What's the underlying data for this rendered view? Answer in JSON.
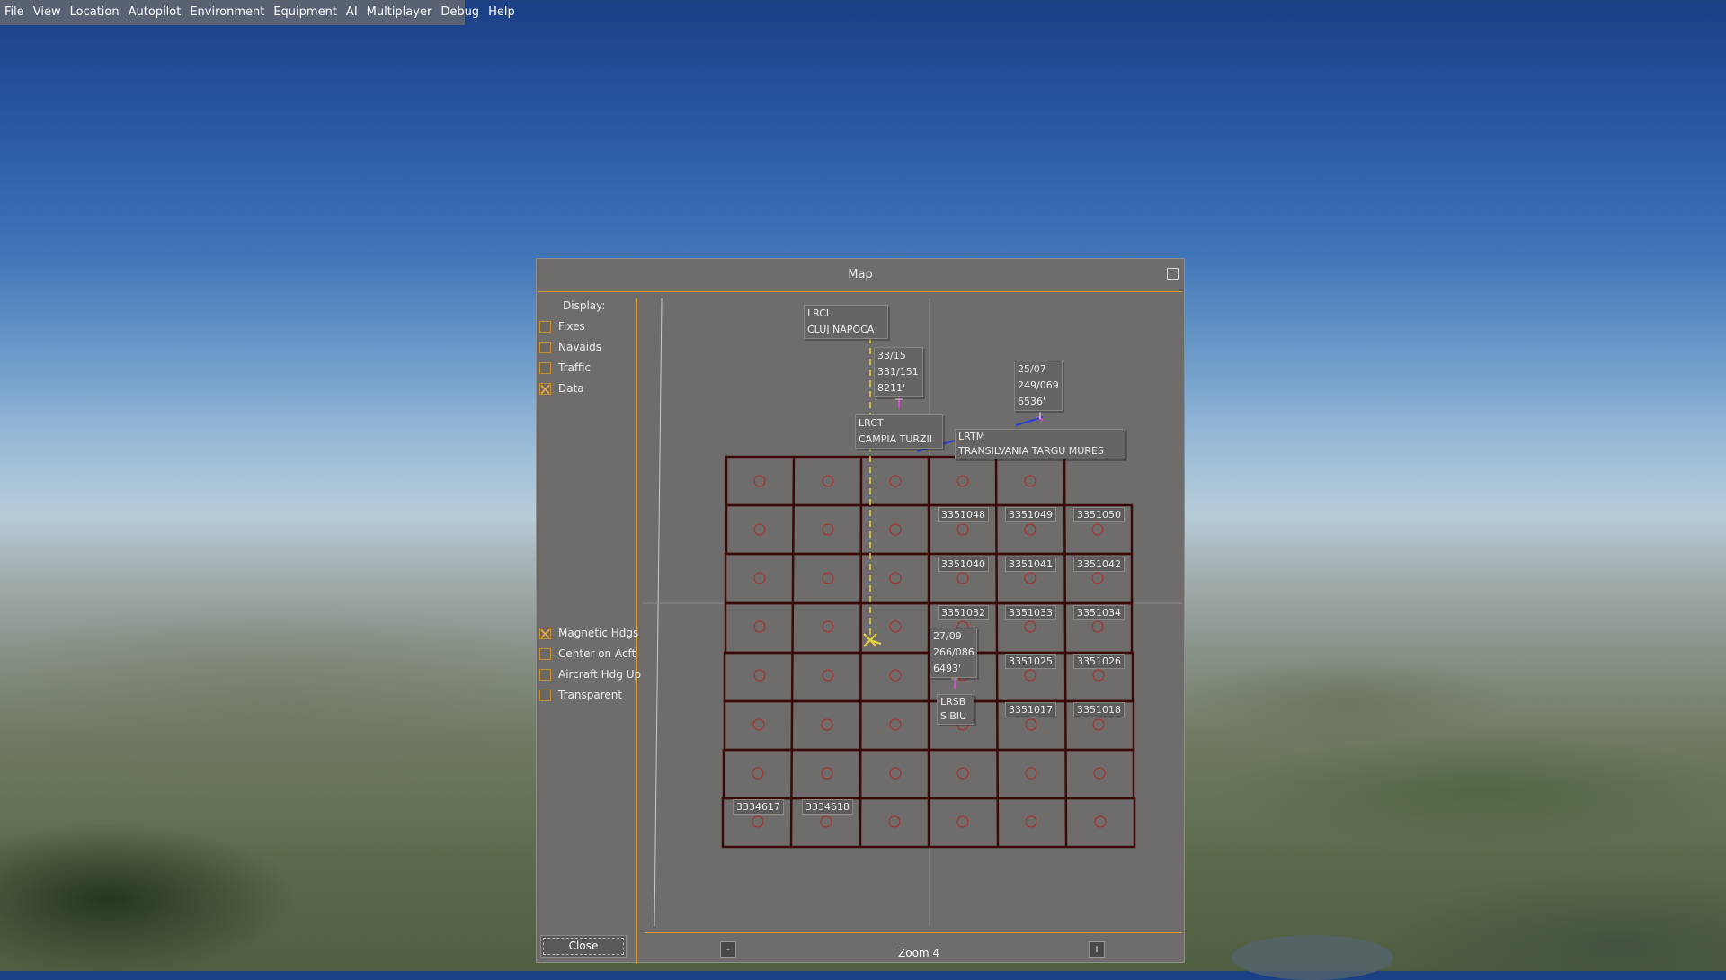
{
  "menu": {
    "items": [
      "File",
      "View",
      "Location",
      "Autopilot",
      "Environment",
      "Equipment",
      "AI",
      "Multiplayer",
      "Debug",
      "Help"
    ]
  },
  "dialog": {
    "title": "Map",
    "display_label": "Display:",
    "display_options": [
      {
        "label": "Fixes",
        "checked": false
      },
      {
        "label": "Navaids",
        "checked": false
      },
      {
        "label": "Traffic",
        "checked": false
      },
      {
        "label": "Data",
        "checked": true
      }
    ],
    "view_options": [
      {
        "label": "Magnetic Hdgs",
        "checked": true
      },
      {
        "label": "Center on Acft",
        "checked": false
      },
      {
        "label": "Aircraft Hdg Up",
        "checked": false
      },
      {
        "label": "Transparent",
        "checked": false
      }
    ],
    "close_label": "Close",
    "zoom_out_label": "-",
    "zoom_in_label": "+",
    "zoom_label": "Zoom 4"
  },
  "map": {
    "airports": [
      {
        "icao": "LRCL",
        "name": "CLUJ NAPOCA"
      },
      {
        "icao": "LRCT",
        "name": "CAMPIA TURZII"
      },
      {
        "icao": "LRTM",
        "name": "TRANSILVANIA TARGU MURES"
      },
      {
        "icao": "LRSB",
        "name": "SIBIU"
      }
    ],
    "runway_data": [
      {
        "runway": "33/15",
        "line2": "331/151",
        "length": "8211'"
      },
      {
        "runway": "25/07",
        "line2": "249/069",
        "length": "6536'"
      },
      {
        "runway": "27/09",
        "line2": "266/086",
        "length": "6493'"
      }
    ],
    "tiles": [
      "3351048",
      "3351049",
      "3351050",
      "3351040",
      "3351041",
      "3351042",
      "3351032",
      "3351033",
      "3351034",
      "3351025",
      "3351026",
      "3351017",
      "3351018",
      "3334617",
      "3334618"
    ]
  },
  "colors": {
    "grid": "#3a0a0a",
    "tile_marker": "#b02a2a",
    "accent": "#d89a2e",
    "route": "#e8d23a"
  }
}
